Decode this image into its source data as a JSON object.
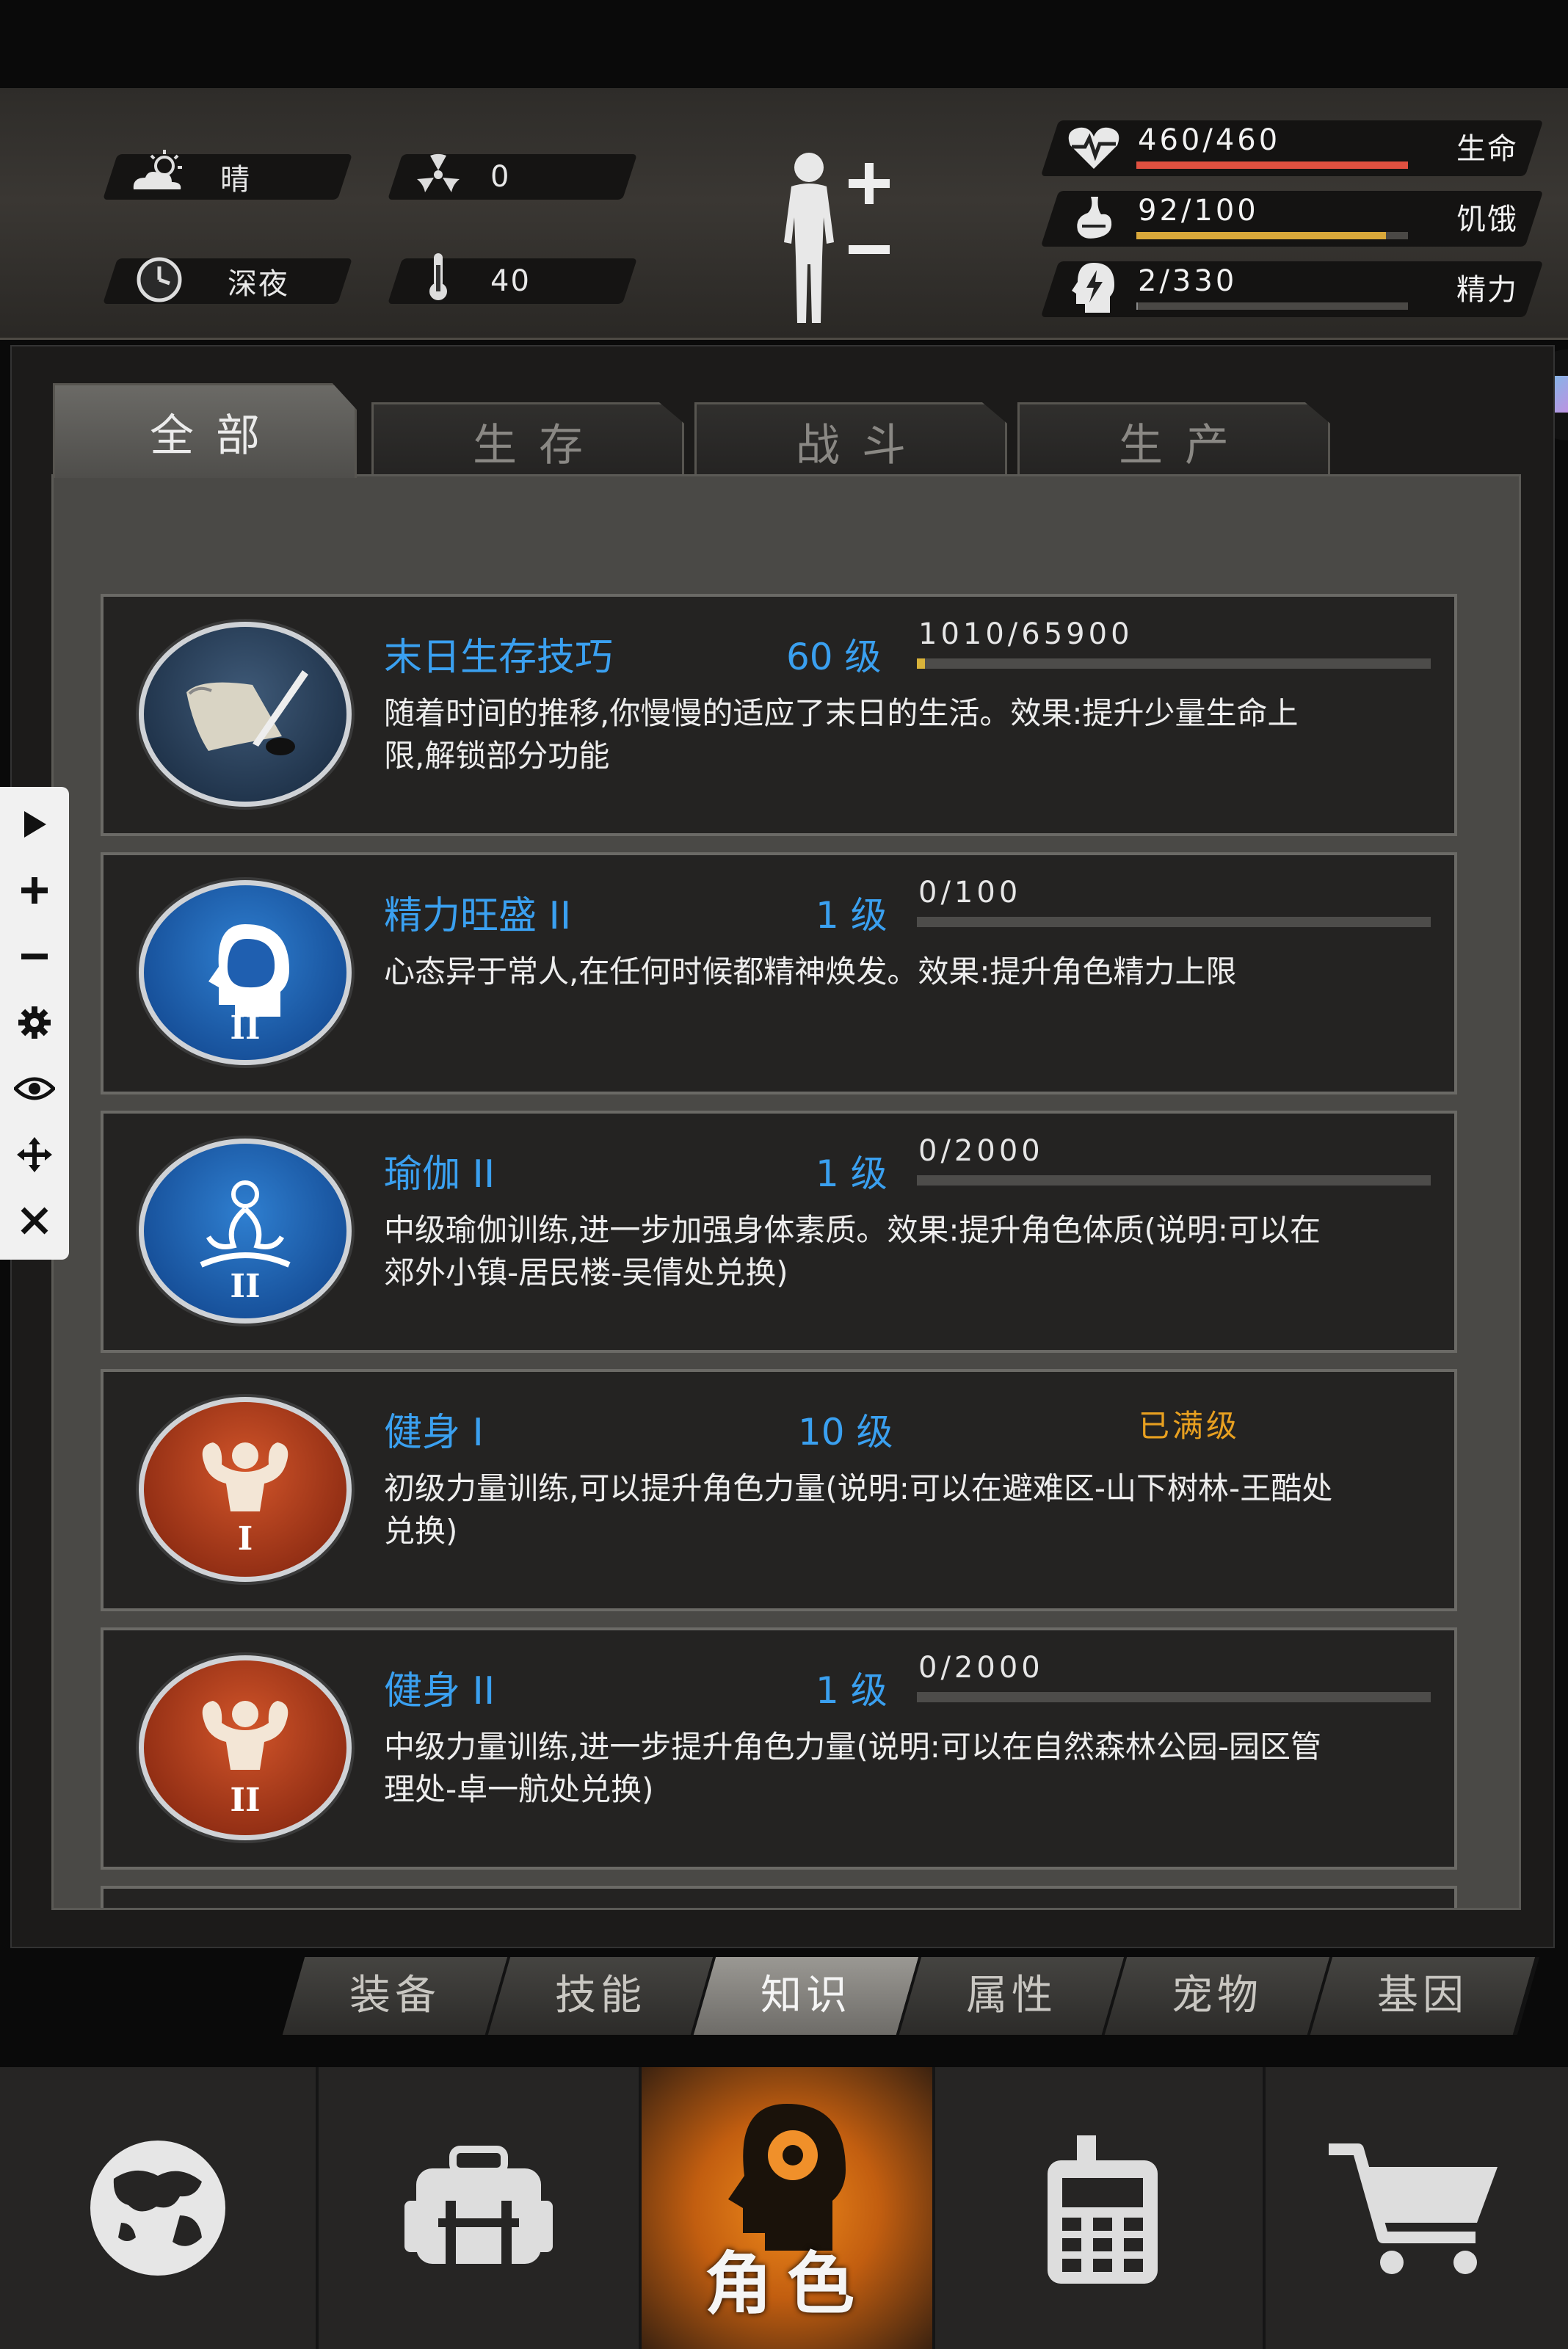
{
  "status": {
    "weather": "晴",
    "radiation": "0",
    "time_of_day": "深夜",
    "temperature": "40",
    "stats": [
      {
        "label": "生命",
        "value": "460/460",
        "current": 460,
        "max": 460,
        "color": "#e05040",
        "icon": "heart-pulse-icon"
      },
      {
        "label": "饥饿",
        "value": "92/100",
        "current": 92,
        "max": 100,
        "color": "#d9a83a",
        "icon": "stomach-icon"
      },
      {
        "label": "精力",
        "value": "2/330",
        "current": 2,
        "max": 330,
        "color": "#8a8a8a",
        "icon": "energy-head-icon"
      }
    ]
  },
  "tabs": [
    "全部",
    "生存",
    "战斗",
    "生产"
  ],
  "active_tab": 0,
  "skills": [
    {
      "title": "末日生存技巧",
      "level": "60 级",
      "progress_text": "1010/65900",
      "progress": 0.0153,
      "maxed_text": "",
      "desc": "随着时间的推移,你慢慢的适应了末日的生活。效果:提升少量生命上限,解锁部分功能",
      "icon": "scroll-quill-icon"
    },
    {
      "title": "精力旺盛 II",
      "level": "1 级",
      "progress_text": "0/100",
      "progress": 0,
      "maxed_text": "",
      "desc": "心态异于常人,在任何时候都精神焕发。效果:提升角色精力上限",
      "icon": "brain-head-icon"
    },
    {
      "title": "瑜伽 II",
      "level": "1 级",
      "progress_text": "0/2000",
      "progress": 0,
      "maxed_text": "",
      "desc": "中级瑜伽训练,进一步加强身体素质。效果:提升角色体质(说明:可以在郊外小镇-居民楼-吴倩处兑换)",
      "icon": "meditation-icon"
    },
    {
      "title": "健身 I",
      "level": "10 级",
      "progress_text": "",
      "progress": 1,
      "maxed_text": "已满级",
      "desc": "初级力量训练,可以提升角色力量(说明:可以在避难区-山下树林-王酷处兑换)",
      "icon": "muscle-icon"
    },
    {
      "title": "健身 II",
      "level": "1 级",
      "progress_text": "0/2000",
      "progress": 0,
      "maxed_text": "",
      "desc": "中级力量训练,进一步提升角色力量(说明:可以在自然森林公园-园区管理处-卓一航处兑换)",
      "icon": "muscle-icon"
    }
  ],
  "subtabs": [
    "装备",
    "技能",
    "知识",
    "属性",
    "宠物",
    "基因"
  ],
  "active_subtab": 2,
  "nav": {
    "active_label": "角色"
  }
}
